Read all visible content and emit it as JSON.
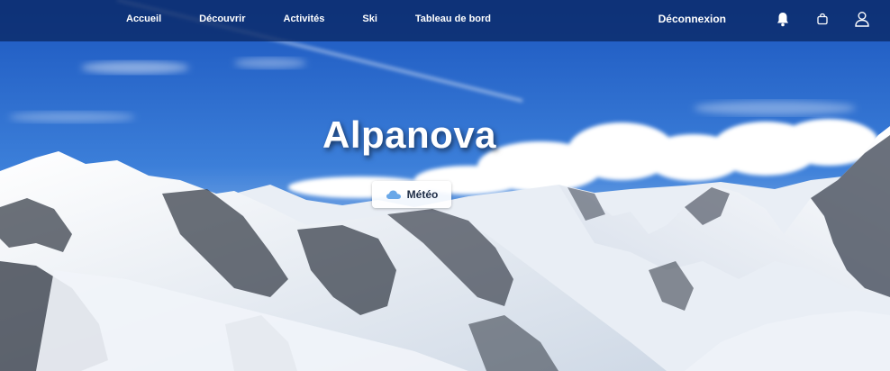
{
  "nav": {
    "links": [
      {
        "label": "Accueil"
      },
      {
        "label": "Découvrir"
      },
      {
        "label": "Activités"
      },
      {
        "label": "Ski"
      },
      {
        "label": "Tableau de bord"
      }
    ],
    "logout_label": "Déconnexion",
    "icons": [
      "bell-icon",
      "bag-icon",
      "user-icon"
    ]
  },
  "hero": {
    "title": "Alpanova",
    "weather_button_label": "Météo",
    "weather_icon": "cloud-icon"
  },
  "colors": {
    "navbar": "#0a2864",
    "sky_top": "#1f5fc9",
    "sky_bottom": "#7fb0ea",
    "snow": "#f4f7fb",
    "rock": "#2e3440",
    "cloud_icon": "#6aa8e8"
  }
}
